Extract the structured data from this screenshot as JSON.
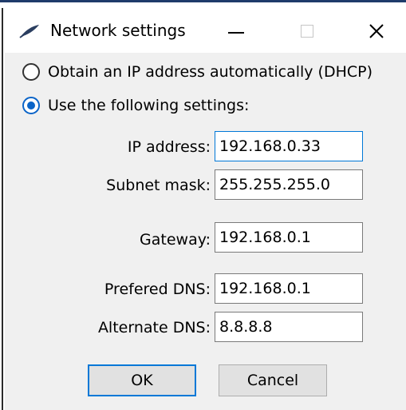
{
  "window": {
    "title": "Network settings"
  },
  "mode": {
    "dhcp_label": "Obtain an IP address automatically (DHCP)",
    "manual_label": "Use the following settings:",
    "selected": "manual"
  },
  "fields": {
    "ip": {
      "label": "IP address:",
      "value": "192.168.0.33"
    },
    "subnet": {
      "label": "Subnet mask:",
      "value": "255.255.255.0"
    },
    "gateway": {
      "label": "Gateway:",
      "value": "192.168.0.1"
    },
    "preferred_dns": {
      "label": "Prefered DNS:",
      "value": "192.168.0.1"
    },
    "alternate_dns": {
      "label": "Alternate DNS:",
      "value": "8.8.8.8"
    }
  },
  "buttons": {
    "ok_label": "OK",
    "cancel_label": "Cancel"
  },
  "colors": {
    "accent": "#0078d7",
    "window_bg": "#f0f0f0"
  },
  "icons": {
    "app": "feather-icon",
    "minimize": "minimize-icon",
    "maximize": "maximize-icon",
    "close": "close-icon"
  }
}
